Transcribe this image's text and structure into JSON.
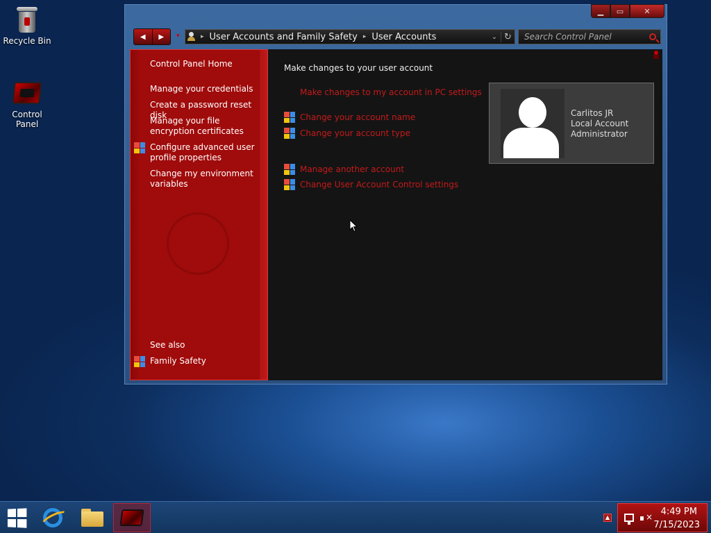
{
  "desktop": {
    "icons": [
      {
        "label": "Recycle Bin",
        "icon": "recycle-bin-icon"
      },
      {
        "label": "Control Panel",
        "icon": "control-panel-icon"
      }
    ]
  },
  "window": {
    "address": {
      "crumbs": [
        "User Accounts and Family Safety",
        "User Accounts"
      ],
      "search_placeholder": "Search Control Panel"
    },
    "sidebar": {
      "home": "Control Panel Home",
      "links": [
        "Manage your credentials",
        "Create a password reset disk",
        "Manage your file encryption certificates",
        "Configure advanced user profile properties",
        "Change my environment variables"
      ],
      "see_also_heading": "See also",
      "see_also": [
        "Family Safety"
      ]
    },
    "main": {
      "heading": "Make changes to your user account",
      "pc_settings_link": "Make changes to my account in PC settings",
      "tasks_primary": [
        "Change your account name",
        "Change your account type"
      ],
      "tasks_secondary": [
        "Manage another account",
        "Change User Account Control settings"
      ],
      "user": {
        "name": "Carlitos JR",
        "account_type": "Local Account",
        "role": "Administrator"
      }
    },
    "colors": {
      "accent": "#a30b0b",
      "link": "#c41a1a",
      "content_bg": "#141414"
    }
  },
  "taskbar": {
    "pinned": [
      "internet-explorer-icon",
      "file-explorer-icon",
      "control-panel-icon"
    ],
    "clock": {
      "time": "4:49 PM",
      "date": "7/15/2023"
    }
  }
}
